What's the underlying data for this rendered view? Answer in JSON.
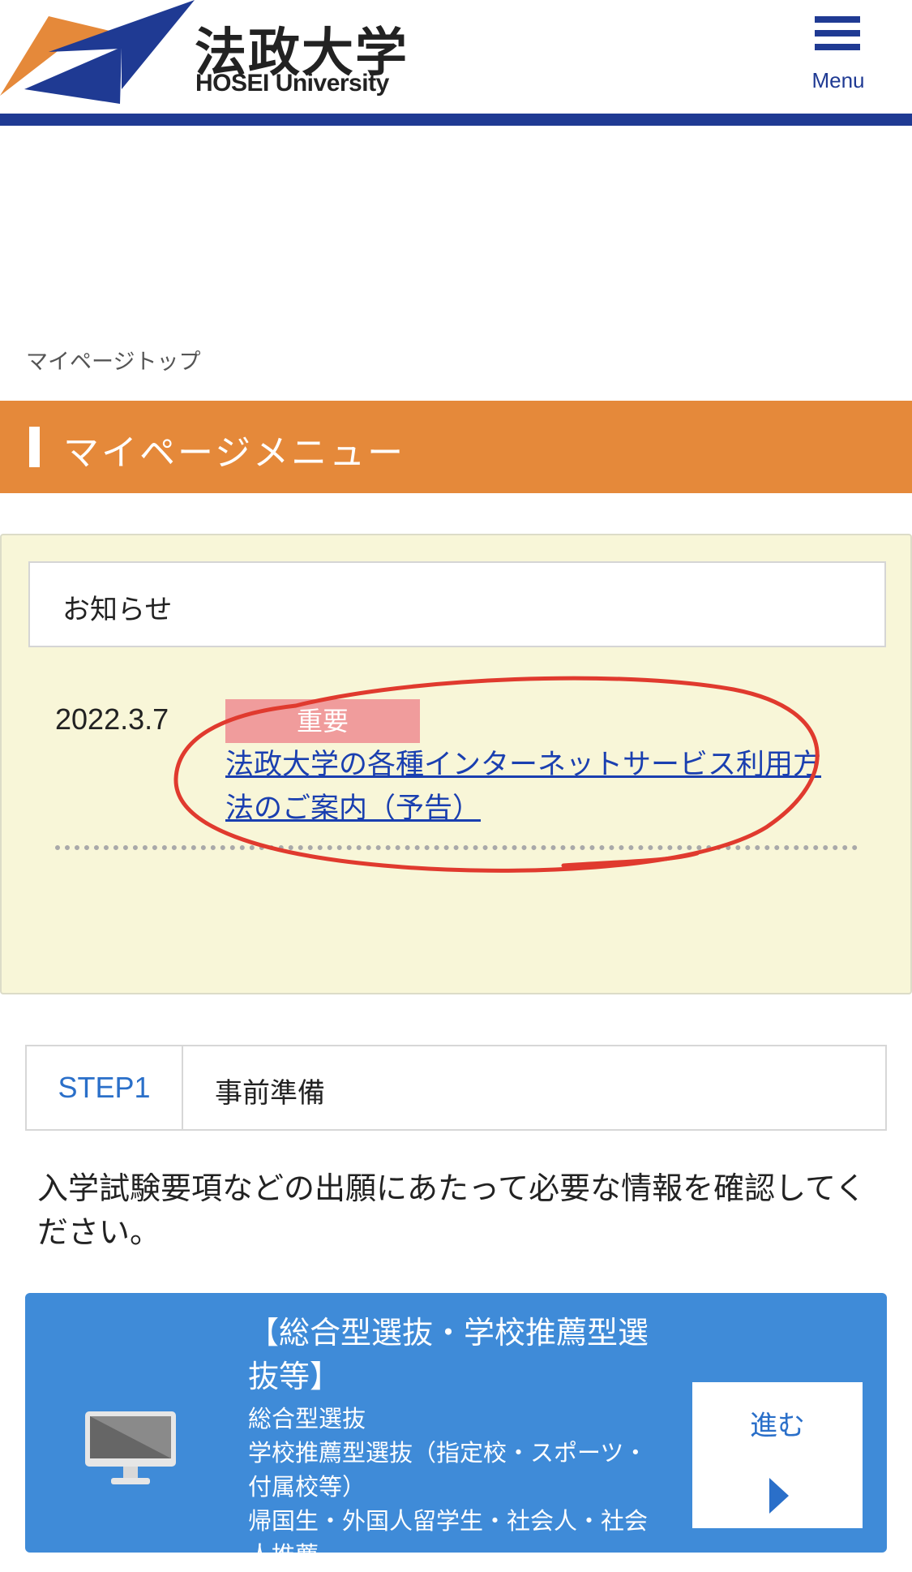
{
  "header": {
    "logo_kanji": "法政大学",
    "logo_roman": "HOSEI University",
    "menu_label": "Menu",
    "brand_blue": "#1f3a93",
    "brand_orange": "#e5893a"
  },
  "breadcrumb": "マイページトップ",
  "section": {
    "title": "マイページメニュー"
  },
  "notice": {
    "heading": "お知らせ",
    "items": [
      {
        "date": "2022.3.7",
        "badge": "重要",
        "link_text": "法政大学の各種インターネットサービス利用方法のご案内（予告）"
      }
    ]
  },
  "step1": {
    "num": "STEP1",
    "title": "事前準備",
    "description": "入学試験要項などの出願にあたって必要な情報を確認してください。"
  },
  "card": {
    "icon": "computer-icon",
    "title": "【総合型選抜・学校推薦型選抜等】",
    "items": [
      "総合型選抜",
      "学校推薦型選抜（指定校・スポーツ・付属校等）",
      "帰国生・外国人留学生・社会人・社会人推薦"
    ],
    "go_label": "進む"
  }
}
